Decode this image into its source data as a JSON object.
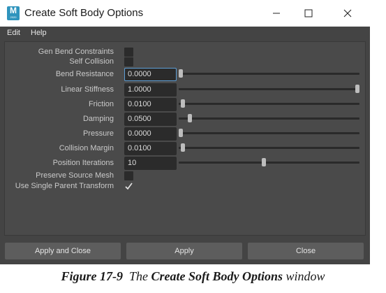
{
  "window": {
    "app_icon_letter": "M",
    "app_icon_sub": "2020",
    "title": "Create Soft Body Options"
  },
  "menu": [
    "Edit",
    "Help"
  ],
  "checkboxes": {
    "gen_bend_constraints": {
      "label": "Gen Bend Constraints",
      "checked": false
    },
    "self_collision": {
      "label": "Self Collision",
      "checked": false
    },
    "preserve_source_mesh": {
      "label": "Preserve Source Mesh",
      "checked": false
    },
    "use_single_parent_transform": {
      "label": "Use Single Parent Transform",
      "checked": true
    }
  },
  "fields": [
    {
      "label": "Bend Resistance",
      "value": "0.0000",
      "slider_level": 0.0
    },
    {
      "label": "Linear Stiffness",
      "value": "1.0000",
      "slider_level": 1.0
    },
    {
      "label": "Friction",
      "value": "0.0100",
      "slider_level": 0.01
    },
    {
      "label": "Damping",
      "value": "0.0500",
      "slider_level": 0.05
    },
    {
      "label": "Pressure",
      "value": "0.0000",
      "slider_level": 0.0
    },
    {
      "label": "Collision Margin",
      "value": "0.0100",
      "slider_level": 0.01
    },
    {
      "label": "Position Iterations",
      "value": "10",
      "slider_level": 0.47
    }
  ],
  "buttons": {
    "apply_and_close": "Apply and Close",
    "apply": "Apply",
    "close": "Close"
  },
  "caption": {
    "figure": "Figure 17-9",
    "the": "The",
    "name": "Create Soft Body Options",
    "suffix": "window"
  }
}
